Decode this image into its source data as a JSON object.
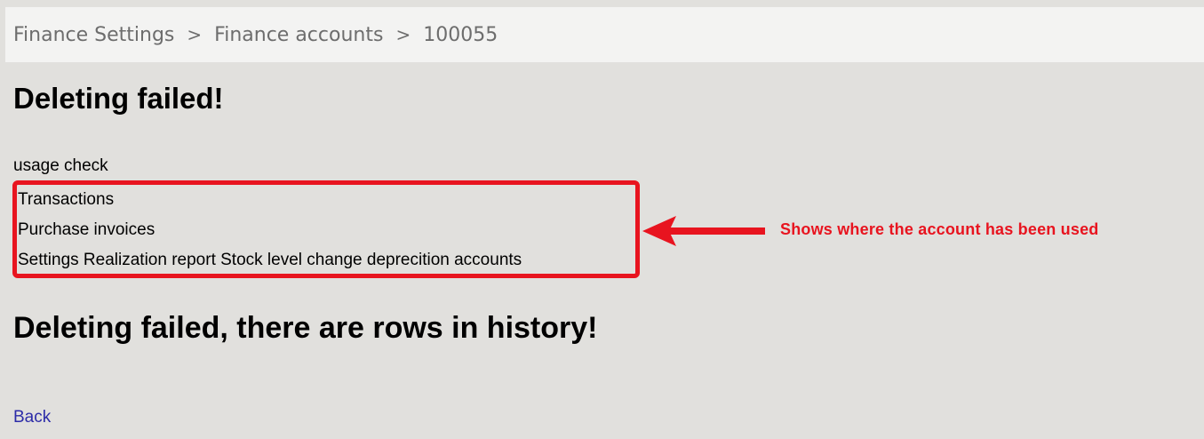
{
  "breadcrumb": {
    "items": [
      "Finance Settings",
      "Finance accounts",
      "100055"
    ],
    "separator": ">"
  },
  "headings": {
    "deleting_failed": "Deleting failed!",
    "history_failed": "Deleting failed, there are rows in history!"
  },
  "usage": {
    "label": "usage check",
    "items": [
      "Transactions",
      "Purchase invoices",
      "Settings Realization report Stock level change deprecition accounts"
    ]
  },
  "annotation": {
    "text": "Shows where the account has been used",
    "color": "#e8141f"
  },
  "back_link": "Back",
  "colors": {
    "page_background": "#e1e0dd",
    "breadcrumb_background": "#f3f3f2",
    "link": "#2d2ca8"
  }
}
